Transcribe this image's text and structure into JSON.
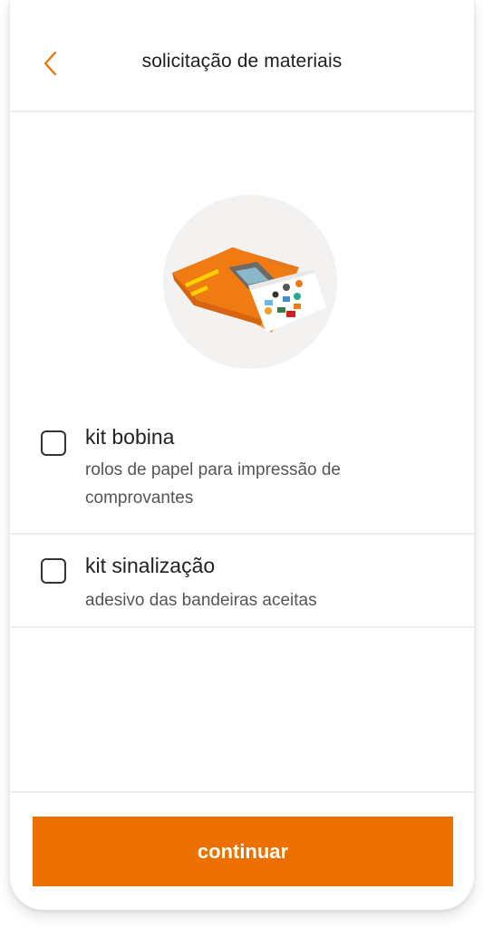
{
  "header": {
    "title": "solicitação de materiais",
    "back_icon": "chevron-left-icon"
  },
  "hero": {
    "illustration": "materials-kit-illustration"
  },
  "options": [
    {
      "title": "kit bobina",
      "description": "rolos de papel para impressão de comprovantes",
      "checked": false
    },
    {
      "title": "kit sinalização",
      "description": "adesivo das bandeiras aceitas",
      "checked": false
    }
  ],
  "footer": {
    "continue_label": "continuar"
  },
  "colors": {
    "accent": "#ec7000",
    "divider": "#eeeeee",
    "hero_bg": "#f4f2f1"
  }
}
